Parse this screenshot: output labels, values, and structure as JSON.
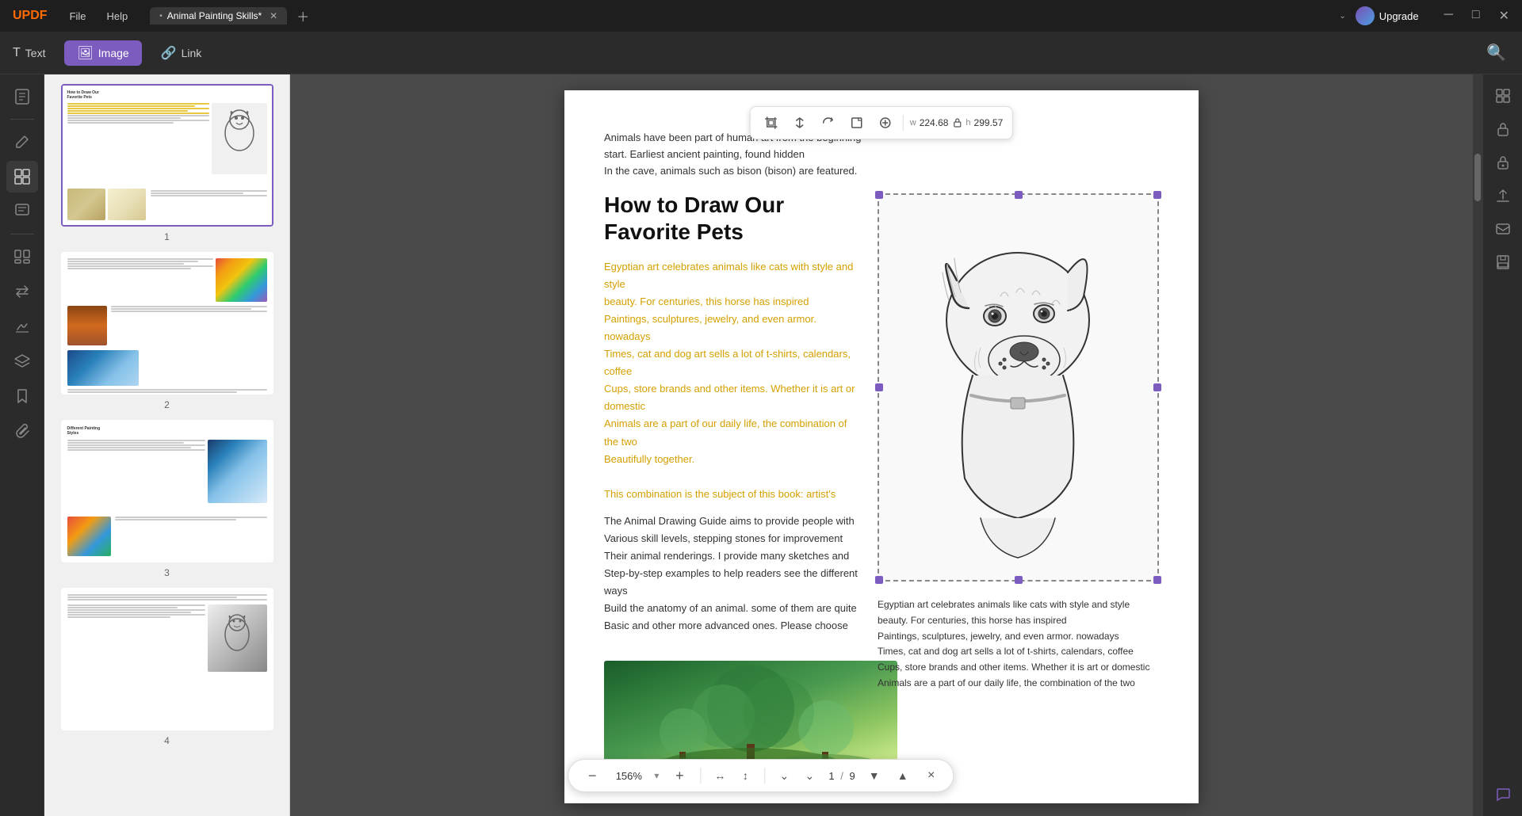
{
  "app": {
    "logo": "UPDF",
    "title": "Animal Painting Skills*",
    "tab_dot": "•"
  },
  "menu": {
    "file": "File",
    "help": "Help"
  },
  "upgrade": {
    "label": "Upgrade"
  },
  "toolbar": {
    "text_label": "Text",
    "image_label": "Image",
    "link_label": "Link"
  },
  "image_toolbar": {
    "w_label": "w",
    "w_value": "224.68",
    "separator": "∂",
    "h_label": "h",
    "h_value": "299.57"
  },
  "pdf_content": {
    "intro": "Animals have been part of human art from the beginning\nstart. Earliest ancient painting, found hidden\nIn the cave, animals such as bison (bison) are featured.",
    "heading_line1": "How to Draw Our",
    "heading_line2": "Favorite Pets",
    "highlighted_text": "Egyptian art celebrates animals like cats with style and style\nbeauty. For centuries, this horse has inspired\nPaintings, sculptures, jewelry, and even armor. nowadays\nTimes, cat and dog art sells a lot of t-shirts, calendars, coffee\nCups, store brands and other items. Whether it is art or domestic\nAnimals are a part of our daily life, the combination of the two\nBeautifully together.\nThis combination is the subject of this book: artist's",
    "body_text": "The Animal Drawing Guide aims to provide people with\nVarious skill levels, stepping stones for improvement\nTheir animal renderings. I provide many sketches and\nStep-by-step examples to help readers see the different ways\nBuild the anatomy of an animal. some of them are quite\nBasic and other more advanced ones. Please choose",
    "right_col_text": "Egyptian art celebrates animals like cats with style and style\nbeauty. For centuries, this horse has inspired\nPaintings, sculptures, jewelry, and even armor. nowadays\nTimes, cat and dog art sells a lot of t-shirts, calendars, coffee\nCups, store brands and other items. Whether it is art or domestic\nAnimals are a part of our daily life, the combination of the two"
  },
  "bottom_toolbar": {
    "zoom_out_icon": "−",
    "zoom_value": "156%",
    "zoom_in_icon": "+",
    "page_current": "1",
    "page_separator": "/",
    "page_total": "9",
    "close_icon": "×"
  },
  "pages": [
    {
      "number": "1"
    },
    {
      "number": "2"
    },
    {
      "number": "3"
    },
    {
      "number": "4"
    }
  ],
  "sidebar_icons": {
    "reading": "📄",
    "edit": "✏️",
    "comment": "💬",
    "organize": "⊞",
    "convert": "↕",
    "sign": "🔖",
    "stamp": "◱",
    "layers": "⊛",
    "bookmark": "🔖",
    "attach": "📎"
  },
  "right_panel_icons": {
    "icon1": "⊞",
    "icon2": "🔒",
    "icon3": "🔒",
    "icon4": "⬆",
    "icon5": "✉",
    "icon6": "💾",
    "icon7": "💬"
  }
}
